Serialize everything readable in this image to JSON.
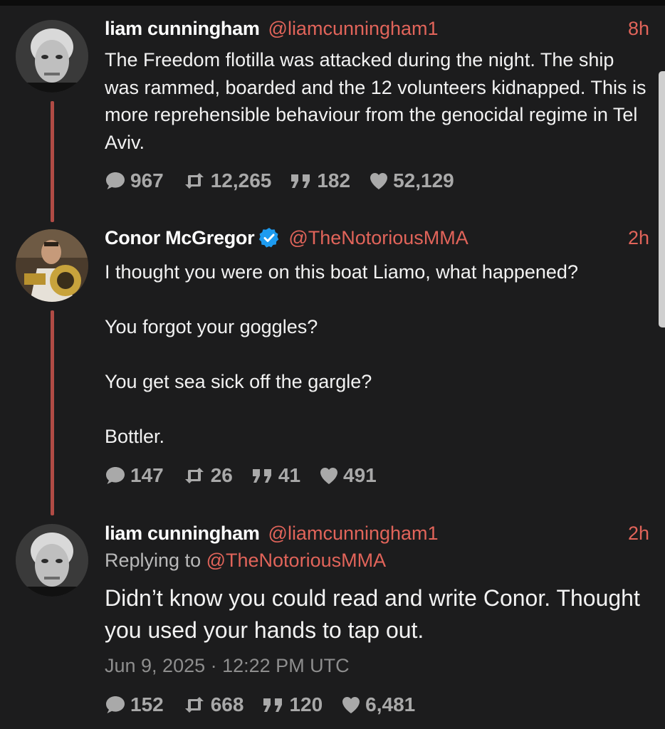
{
  "colors": {
    "background": "#1c1c1d",
    "accent": "#e1645a",
    "thread_line": "#b04b45",
    "stat_gray": "#a9a9a9",
    "verified": "#1d9bf0"
  },
  "tweets": [
    {
      "name": "liam cunningham",
      "handle": "@liamcunningham1",
      "time": "8h",
      "text": "The Freedom flotilla was attacked during the night. The ship was rammed, boarded and the 12 volunteers kidnapped. This is more reprehensible behaviour from the genocidal regime in Tel Aviv.",
      "stats": {
        "replies": "967",
        "retweets": "12,265",
        "quotes": "182",
        "likes": "52,129"
      },
      "avatar_icon": "avatar-photo"
    },
    {
      "name": "Conor McGregor",
      "verified": true,
      "verified_icon": "verified-badge-icon",
      "handle": "@TheNotoriousMMA",
      "time": "2h",
      "text": "I thought you were on this boat Liamo, what happened?\n\nYou forgot your goggles?\n\nYou get sea sick off the gargle?\n\nBottler.",
      "stats": {
        "replies": "147",
        "retweets": "26",
        "quotes": "41",
        "likes": "491"
      },
      "avatar_icon": "avatar-photo"
    },
    {
      "name": "liam cunningham",
      "handle": "@liamcunningham1",
      "time": "2h",
      "replying_label": "Replying to",
      "replying_handle": "@TheNotoriousMMA",
      "text": "Didn’t know you could read and write Conor. Thought you used your hands to tap out.",
      "date": "Jun 9, 2025 · 12:22 PM UTC",
      "stats": {
        "replies": "152",
        "retweets": "668",
        "quotes": "120",
        "likes": "6,481"
      },
      "avatar_icon": "avatar-photo"
    }
  ],
  "icons": {
    "reply": "comment-icon",
    "retweet": "retweet-icon",
    "quote": "quote-icon",
    "like": "heart-icon"
  }
}
